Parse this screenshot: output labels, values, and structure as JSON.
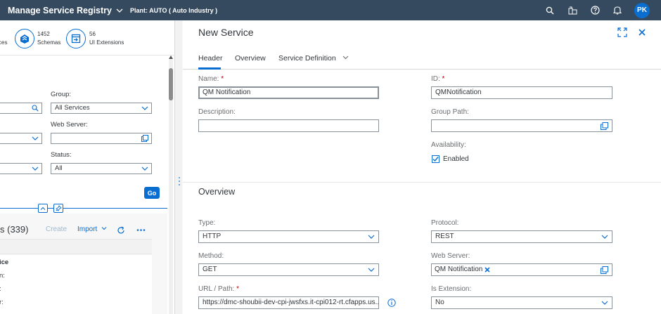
{
  "shell": {
    "title": "Manage Service Registry",
    "plant": "Plant: AUTO ( Auto Industry )",
    "avatar": "PK",
    "icons": [
      "search-icon",
      "building-icon",
      "help-icon",
      "bell-icon"
    ]
  },
  "left": {
    "kpis": [
      {
        "count": "",
        "label": "ces"
      },
      {
        "count": "1452",
        "label": "Schemas",
        "icon": "schema-icon"
      },
      {
        "count": "56",
        "label": "UI Extensions",
        "icon": "ui-extension-icon"
      }
    ],
    "filters": {
      "group_label": "Group:",
      "group_value": "All Services",
      "webserver_label": "Web Server:",
      "webserver_value": "",
      "status_label": "Status:",
      "status_value": "All",
      "go_label": "Go"
    },
    "table": {
      "title": "s (339)",
      "create_label": "Create",
      "import_label": "Import",
      "rows": [
        "ice",
        "n:",
        ":",
        "r:"
      ]
    }
  },
  "right": {
    "title": "New Service",
    "tabs": [
      "Header",
      "Overview",
      "Service Definition"
    ],
    "header": {
      "name_label": "Name:",
      "name_value": "QM Notification",
      "id_label": "ID:",
      "id_value": "QMNotification",
      "description_label": "Description:",
      "description_value": "",
      "group_path_label": "Group Path:",
      "group_path_value": "",
      "availability_label": "Availability:",
      "enabled_label": "Enabled",
      "enabled_checked": true
    },
    "overview": {
      "title": "Overview",
      "type_label": "Type:",
      "type_value": "HTTP",
      "protocol_label": "Protocol:",
      "protocol_value": "REST",
      "method_label": "Method:",
      "method_value": "GET",
      "webserver_label": "Web Server:",
      "webserver_token": "QM Notification",
      "url_label": "URL / Path:",
      "url_value": "https://dmc-shoubii-dev-cpi-jwsfxs.it-cpi012-rt.cfapps.us...",
      "extension_label": "Is Extension:",
      "extension_value": "No"
    }
  },
  "colors": {
    "shell": "#354a5f",
    "accent": "#0a6ed1",
    "required": "#bb0000"
  }
}
